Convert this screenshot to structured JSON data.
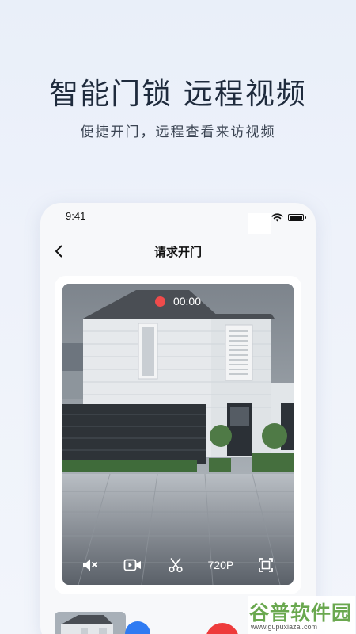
{
  "promo": {
    "headline": "智能门锁 远程视频",
    "subline": "便捷开门，远程查看来访视频"
  },
  "status_bar": {
    "time": "9:41",
    "icons": [
      "wifi-icon",
      "battery-icon"
    ]
  },
  "nav": {
    "back_icon": "chevron-left-icon",
    "title": "请求开门"
  },
  "video": {
    "recording_time": "00:00",
    "recording_color": "#ef4b4b",
    "controls": {
      "mute_icon": "speaker-mute-icon",
      "record_icon": "video-camera-icon",
      "snapshot_icon": "scissors-icon",
      "resolution": "720P",
      "fullscreen_icon": "fullscreen-icon"
    }
  },
  "actions": {
    "blue_button_color": "#2f7bf2",
    "red_button_color": "#ee3b3b"
  },
  "watermark": {
    "text": "谷普软件园",
    "url": "www.gupuxiazai.com"
  }
}
